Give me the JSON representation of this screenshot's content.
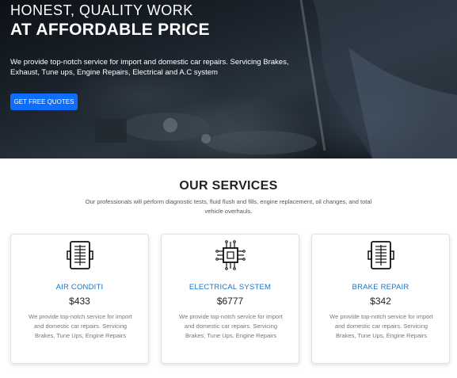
{
  "hero": {
    "tagline": "HONEST, QUALITY WORK",
    "title": "AT AFFORDABLE PRICE",
    "description": "We provide top-notch service for import and domestic car repairs. Servicing Brakes, Exhaust, Tune ups, Engine Repairs, Electrical and A.C system",
    "cta_label": "GET FREE QUOTES"
  },
  "services": {
    "title": "OUR SERVICES",
    "description": "Our professionals will perform diagnostic tests, fluid flush and fills, engine replacement, oil changes, and total vehicle overhauls.",
    "cards": [
      {
        "icon": "air-filter-icon",
        "name": "AIR CONDITI",
        "price": "$433",
        "text": "We provide top-notch service for import and domestic car repairs. Servicing Brakes, Tune Ups, Engine Repairs"
      },
      {
        "icon": "microchip-icon",
        "name": "ELECTRICAL SYSTEM",
        "price": "$6777",
        "text": "We provide top-notch service for import and domestic car repairs. Servicing Brakes, Tune Ups, Engine Repairs"
      },
      {
        "icon": "air-filter-icon",
        "name": "BRAKE REPAIR",
        "price": "$342",
        "text": "We provide top-notch service for import and domestic car repairs. Servicing Brakes, Tune Ups, Engine Repairs"
      }
    ]
  },
  "colors": {
    "accent": "#0d6efd",
    "service_name": "#1a73c8"
  }
}
